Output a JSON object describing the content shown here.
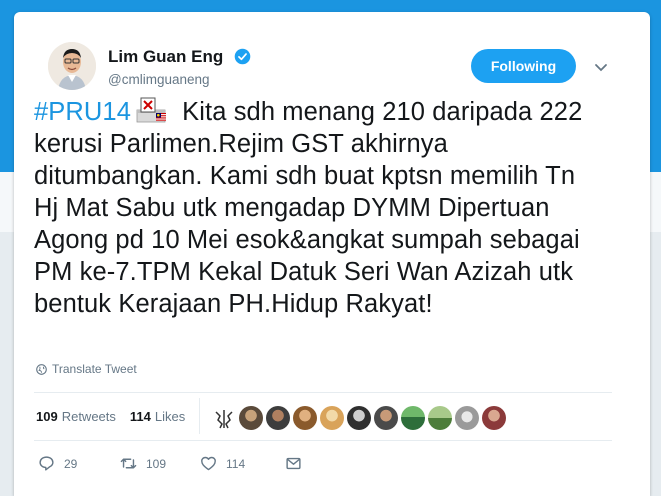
{
  "user": {
    "name": "Lim Guan Eng",
    "handle": "@cmlimguaneng",
    "verified": true
  },
  "follow_button": "Following",
  "tweet": {
    "hashtag": "#PRU14",
    "emoji": "ballot-box-with-flag",
    "text": " Kita sdh menang 210 daripada 222 kerusi Parlimen.Rejim GST akhirnya ditumbangkan. Kami sdh buat kptsn memilih Tn Hj Mat Sabu utk mengadap DYMM Dipertuan Agong pd 10 Mei esok&angkat sumpah sebagai PM ke-7.TPM Kekal Datuk Seri Wan Azizah utk bentuk Kerajaan PH.Hidup Rakyat!"
  },
  "translate_label": "Translate Tweet",
  "stats": {
    "retweets_count": "109",
    "retweets_label": "Retweets",
    "likes_count": "114",
    "likes_label": "Likes"
  },
  "liker_avatars": [
    "#5a4a3a",
    "#3d3d3d",
    "#8a5a2c",
    "#d9a35a",
    "#2f2f2f",
    "#4a4a4a",
    "#2d6e3a",
    "#4d7d3a",
    "#9a9a9a",
    "#8b3a3a"
  ],
  "actions": {
    "reply_count": "29",
    "retweet_count": "109",
    "like_count": "114"
  },
  "colors": {
    "accent": "#1da1f2",
    "link": "#1b95e0",
    "muted": "#657786"
  }
}
